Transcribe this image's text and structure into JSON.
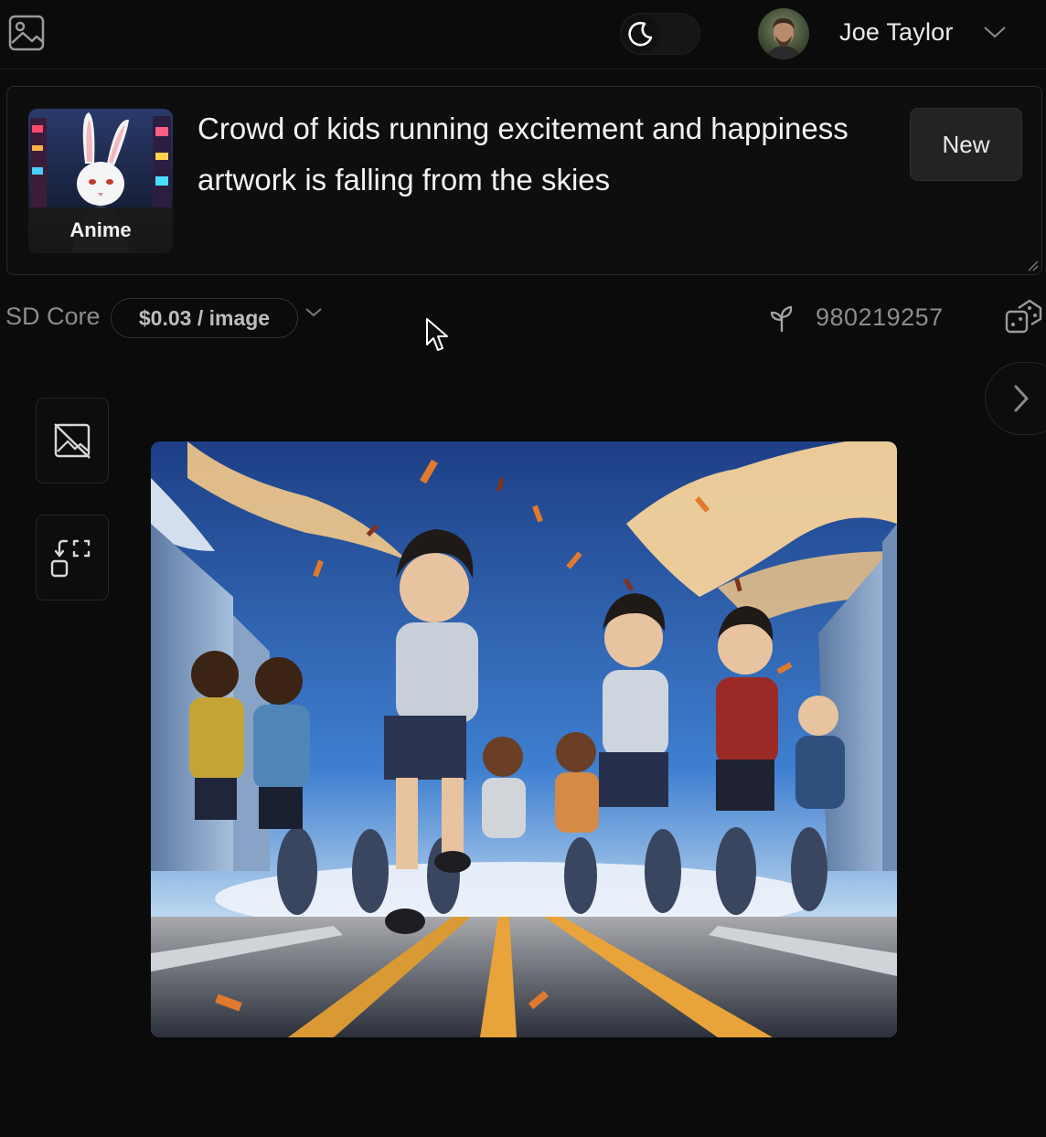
{
  "header": {
    "logo_icon": "image-icon",
    "theme_toggle_icon": "moon-icon",
    "user": {
      "name": "Joe Taylor",
      "menu_icon": "chevron-down-icon"
    }
  },
  "prompt": {
    "style": {
      "label": "Anime",
      "thumbnail_icon": "rabbit-anime-thumbnail"
    },
    "text": "Crowd of kids running excitement and happiness artwork is falling from the skies",
    "new_button_label": "New"
  },
  "model": {
    "name": "SD Core",
    "price": "$0.03 / image",
    "seed_icon": "sprout-icon",
    "seed": "980219257",
    "randomize_icon": "dice-icon"
  },
  "tools": [
    {
      "icon": "image-off-icon"
    },
    {
      "icon": "resize-frame-icon"
    }
  ],
  "gallery": {
    "next_icon": "chevron-right-icon",
    "result_image_icon": "generated-anime-image"
  },
  "colors": {
    "background": "#0b0b0b",
    "card": "#0e0e0e",
    "border": "#2a2a2a",
    "text": "#f2f2f2",
    "muted": "#8c8c8c"
  }
}
